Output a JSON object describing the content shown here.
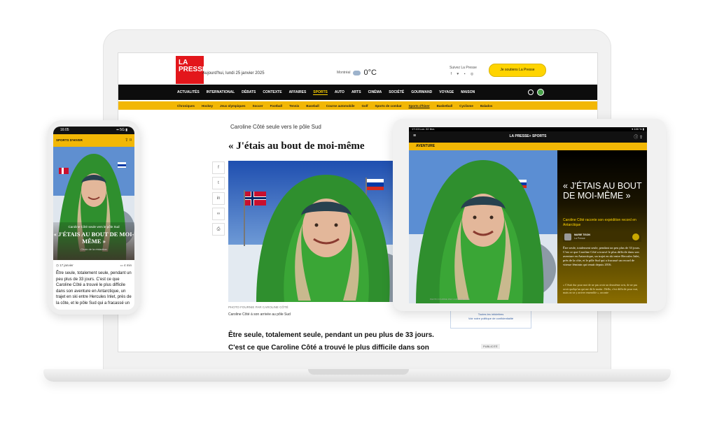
{
  "laptop": {
    "logo_line1": "LA",
    "logo_line2": "PRESSE",
    "date": "Aujourd'hui, lundi 25 janvier 2025",
    "weather_city": "Montréal",
    "weather_temp": "0°C",
    "follow_label": "Suivez La Presse",
    "social_icons": "f ♥ ▪ ◎",
    "support_button": "Je soutiens La Presse",
    "nav": [
      "ACTUALITÉS",
      "INTERNATIONAL",
      "DÉBATS",
      "CONTEXTE",
      "AFFAIRES",
      "SPORTS",
      "AUTO",
      "ARTS",
      "CINÉMA",
      "SOCIÉTÉ",
      "GOURMAND",
      "VOYAGE",
      "MAISON"
    ],
    "nav_active": "SPORTS",
    "subnav": [
      "Chroniques",
      "Hockey",
      "Jeux olympiques",
      "Soccer",
      "Football",
      "Tennis",
      "Baseball",
      "Course automobile",
      "Golf",
      "Sports de combat",
      "Sports d'hiver",
      "Basketball",
      "Cyclisme",
      "Balados"
    ],
    "subnav_active": "Sports d'hiver",
    "kicker": "Caroline Côté seule vers le pôle Sud",
    "title": "« J'étais au bout de moi-même",
    "photo_credit": "PHOTO FOURNIE PAR CAROLINE CÔTÉ",
    "photo_caption": "Caroline Côté à son arrivée au pôle Sud",
    "body": "Être seule, totalement seule, pendant un peu plus de 33 jours. C'est ce que Caroline Côté a trouvé le plus difficile dans son aventure en",
    "side_box_line1": "Toutes les infolettres",
    "side_box_line2": "Voir notre politique de confidentialité",
    "ad_label": "PUBLICITÉ"
  },
  "phone": {
    "time": "16:05",
    "signal": "▪▪ 5G ▮",
    "section": "SPORTS D'HIVER",
    "kicker": "Caroline Côté seule vers le pôle Sud",
    "title": "« J'ÉTAIS AU BOUT DE MOI-MÊME »",
    "byline": "Choix de la rédaction",
    "date": "◷ 17 janvier",
    "read_time": "▭ 4 min",
    "body": "Être seule, totalement seule, pendant un peu plus de 33 jours. C'est ce que Caroline Côté a trouvé le plus difficile dans son aventure en Antarctique, un trajet en ski entre Hercules Inlet, près de la côte, et le pôle Sud qui a fracassé un"
  },
  "tablet": {
    "time": "17:13  Lun. 22 févr.",
    "battery": "▾ 100 % ▮",
    "brand": "LA PRESSE+ SPORTS",
    "section": "AVENTURE",
    "title": "« J'ÉTAIS AU BOUT DE MOI-MÊME »",
    "subtitle": "Caroline Côté raconte son expédition record en Antarctique",
    "author_name": "MARIE TISON",
    "author_org": "La Presse",
    "body": "Être seule, totalement seule, pendant un peu plus de 33 jours. C'est ce que Caroline Côté a trouvé le plus difficile dans son aventure en Antarctique, un trajet en ski entre Hercules Inlet, près de la côte, et le pôle Sud qui a fracassé un record de vitesse féminin qui tenait depuis 2016.",
    "body2": "« C'était dur pour moi de ne pas avoir un deuxième avis, de ne pas avoir quelqu'un qui me dit le matin : Hello, c'est difficile pour vrai, mais on va y arriver ensemble », raconte",
    "photo_credit": "PHOTO FOURNIE PAR CAROLINE CÔTÉ"
  },
  "colors": {
    "brand_red": "#e3161b",
    "accent_yellow": "#f2b705",
    "nav_black": "#0d0d0d"
  }
}
